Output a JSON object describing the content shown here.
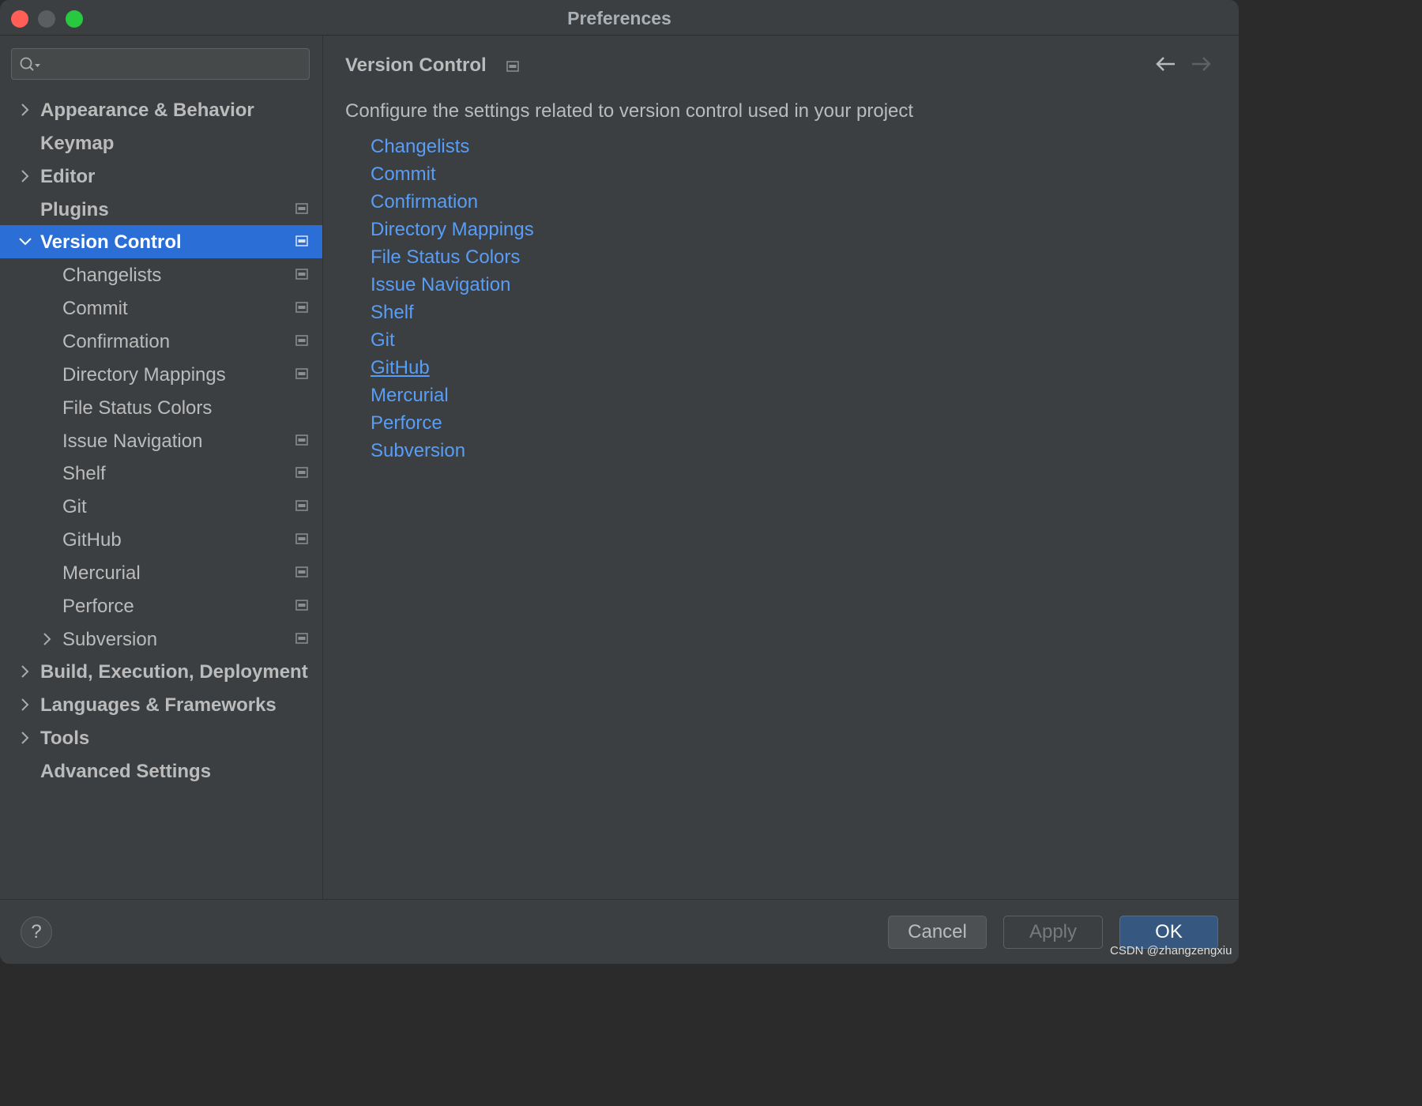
{
  "window": {
    "title": "Preferences"
  },
  "sidebar": {
    "search_placeholder": "",
    "items": [
      {
        "label": "Appearance & Behavior",
        "level": 0,
        "expandable": true,
        "expanded": false,
        "badge": false,
        "bold": true
      },
      {
        "label": "Keymap",
        "level": 0,
        "expandable": false,
        "badge": false,
        "bold": true
      },
      {
        "label": "Editor",
        "level": 0,
        "expandable": true,
        "expanded": false,
        "badge": false,
        "bold": true
      },
      {
        "label": "Plugins",
        "level": 0,
        "expandable": false,
        "badge": true,
        "bold": true
      },
      {
        "label": "Version Control",
        "level": 0,
        "expandable": true,
        "expanded": true,
        "badge": true,
        "bold": true,
        "selected": true
      },
      {
        "label": "Changelists",
        "level": 1,
        "expandable": false,
        "badge": true
      },
      {
        "label": "Commit",
        "level": 1,
        "expandable": false,
        "badge": true
      },
      {
        "label": "Confirmation",
        "level": 1,
        "expandable": false,
        "badge": true
      },
      {
        "label": "Directory Mappings",
        "level": 1,
        "expandable": false,
        "badge": true
      },
      {
        "label": "File Status Colors",
        "level": 1,
        "expandable": false,
        "badge": false
      },
      {
        "label": "Issue Navigation",
        "level": 1,
        "expandable": false,
        "badge": true
      },
      {
        "label": "Shelf",
        "level": 1,
        "expandable": false,
        "badge": true
      },
      {
        "label": "Git",
        "level": 1,
        "expandable": false,
        "badge": true
      },
      {
        "label": "GitHub",
        "level": 1,
        "expandable": false,
        "badge": true
      },
      {
        "label": "Mercurial",
        "level": 1,
        "expandable": false,
        "badge": true
      },
      {
        "label": "Perforce",
        "level": 1,
        "expandable": false,
        "badge": true
      },
      {
        "label": "Subversion",
        "level": 1,
        "expandable": true,
        "expanded": false,
        "badge": true
      },
      {
        "label": "Build, Execution, Deployment",
        "level": 0,
        "expandable": true,
        "expanded": false,
        "badge": false,
        "bold": true
      },
      {
        "label": "Languages & Frameworks",
        "level": 0,
        "expandable": true,
        "expanded": false,
        "badge": false,
        "bold": true
      },
      {
        "label": "Tools",
        "level": 0,
        "expandable": true,
        "expanded": false,
        "badge": false,
        "bold": true
      },
      {
        "label": "Advanced Settings",
        "level": 0,
        "expandable": false,
        "badge": false,
        "bold": true
      }
    ]
  },
  "content": {
    "title": "Version Control",
    "description": "Configure the settings related to version control used in your project",
    "links": [
      {
        "label": "Changelists"
      },
      {
        "label": "Commit"
      },
      {
        "label": "Confirmation"
      },
      {
        "label": "Directory Mappings"
      },
      {
        "label": "File Status Colors"
      },
      {
        "label": "Issue Navigation"
      },
      {
        "label": "Shelf"
      },
      {
        "label": "Git"
      },
      {
        "label": "GitHub",
        "hovered": true
      },
      {
        "label": "Mercurial"
      },
      {
        "label": "Perforce"
      },
      {
        "label": "Subversion"
      }
    ]
  },
  "footer": {
    "help_label": "?",
    "cancel_label": "Cancel",
    "apply_label": "Apply",
    "ok_label": "OK",
    "watermark": "CSDN @zhangzengxiu"
  },
  "colors": {
    "background": "#3c3f41",
    "selection": "#2b6fd6",
    "link": "#589df6",
    "text": "#bbbbbb",
    "ok_button": "#365880"
  },
  "icons": {
    "search": "search-icon",
    "chevron_right": "chevron-right-icon",
    "chevron_down": "chevron-down-icon",
    "project_badge": "project-level-icon",
    "back": "arrow-left-icon",
    "forward": "arrow-right-icon"
  }
}
